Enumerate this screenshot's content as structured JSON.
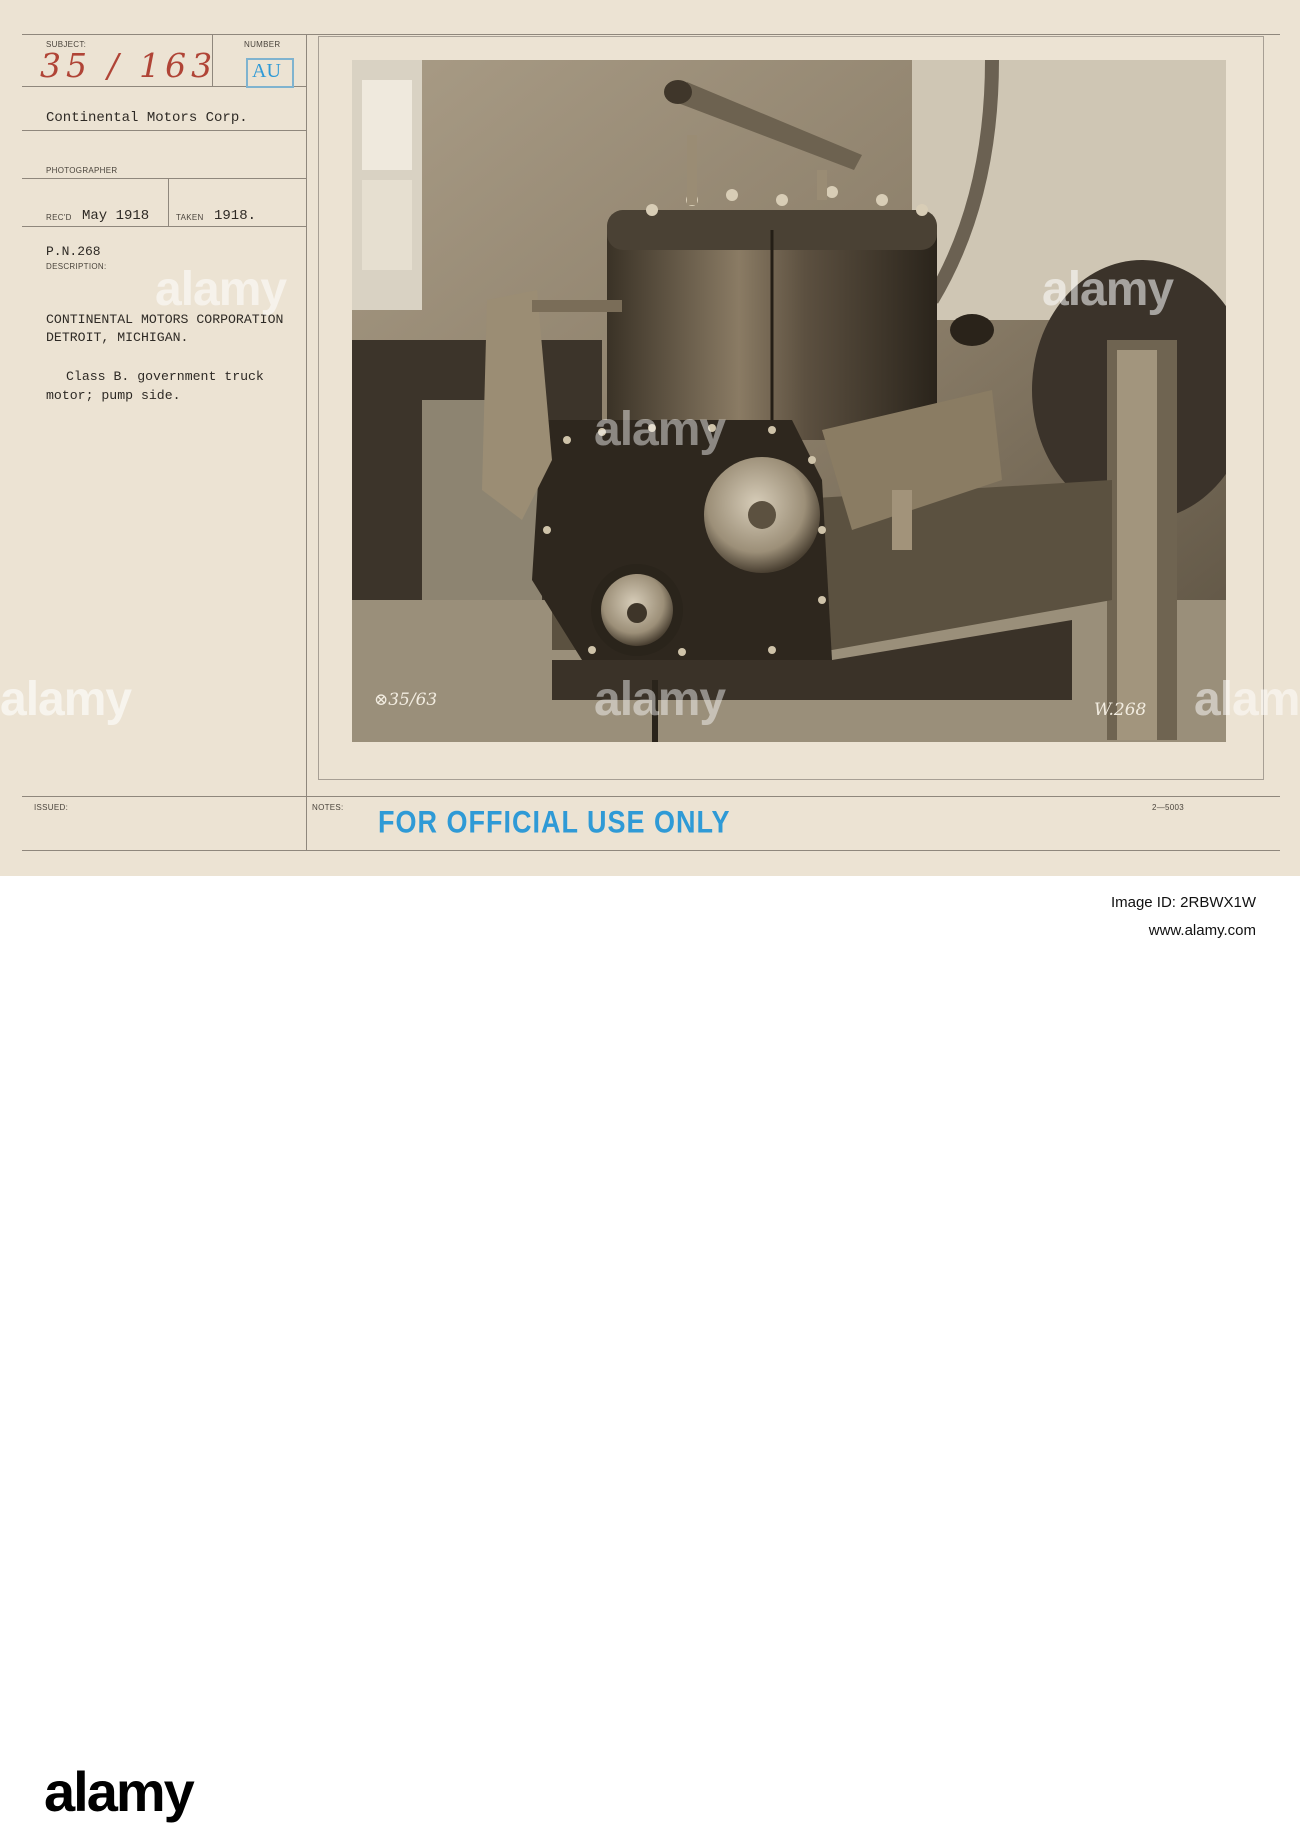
{
  "card": {
    "subject_label": "SUBJECT:",
    "subject_value": "35 / 163",
    "number_label": "NUMBER",
    "number_value": "AU",
    "company": "Continental Motors Corp.",
    "photographer_label": "PHOTOGRAPHER",
    "recd_label": "REC'D",
    "recd_value": "May 1918",
    "taken_label": "TAKEN",
    "taken_value": "1918.",
    "pn": "P.N.268",
    "description_label": "DESCRIPTION:",
    "desc_line1": "CONTINENTAL MOTORS CORPORATION",
    "desc_line2": "DETROIT, MICHIGAN.",
    "desc_line3": "Class B. government truck",
    "desc_line4": "motor; pump side.",
    "issued_label": "ISSUED:",
    "notes_label": "NOTES:",
    "stamp": "FOR OFFICIAL USE ONLY",
    "form_code": "2—5003"
  },
  "photo": {
    "plate_number_left": "⊗35/63",
    "plate_number_right": "W.268"
  },
  "watermark": {
    "text": "alamy"
  },
  "footer": {
    "logo": "alamy",
    "image_id_label": "Image ID: 2RBWX1W",
    "url": "www.alamy.com"
  },
  "colors": {
    "card_background": "#ece3d3",
    "handwriting": "#b04436",
    "stamp_blue": "#2f9ad6"
  }
}
